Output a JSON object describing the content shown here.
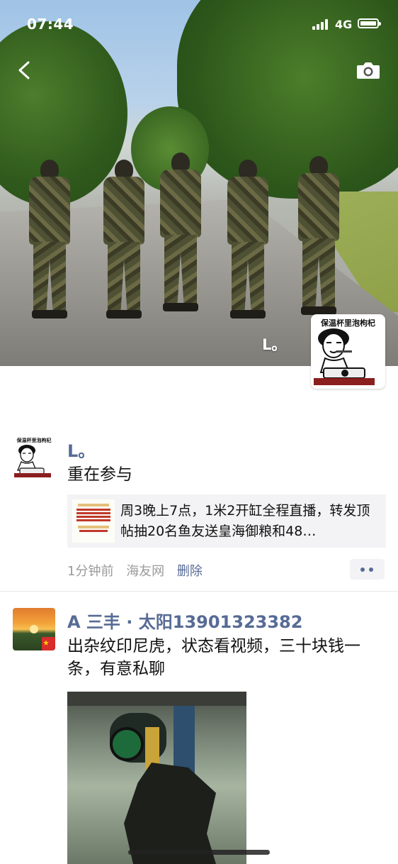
{
  "status_bar": {
    "time": "07:44",
    "network": "4G"
  },
  "cover": {
    "name": "L。",
    "avatar_caption": "保温杯里泡枸杞"
  },
  "post1": {
    "avatar_caption": "保温杯里泡枸杞",
    "nickname": "L。",
    "text": "重在参与",
    "share": {
      "title": "周3晚上7点，1米2开缸全程直播，转发顶帖抽20名鱼友送皇海御粮和48…"
    },
    "time": "1分钟前",
    "source": "海友网",
    "delete_label": "删除"
  },
  "post2": {
    "nickname": "A 三丰 · 太阳13901323382",
    "text": "出杂纹印尼虎，状态看视频，三十块钱一条，有意私聊"
  }
}
